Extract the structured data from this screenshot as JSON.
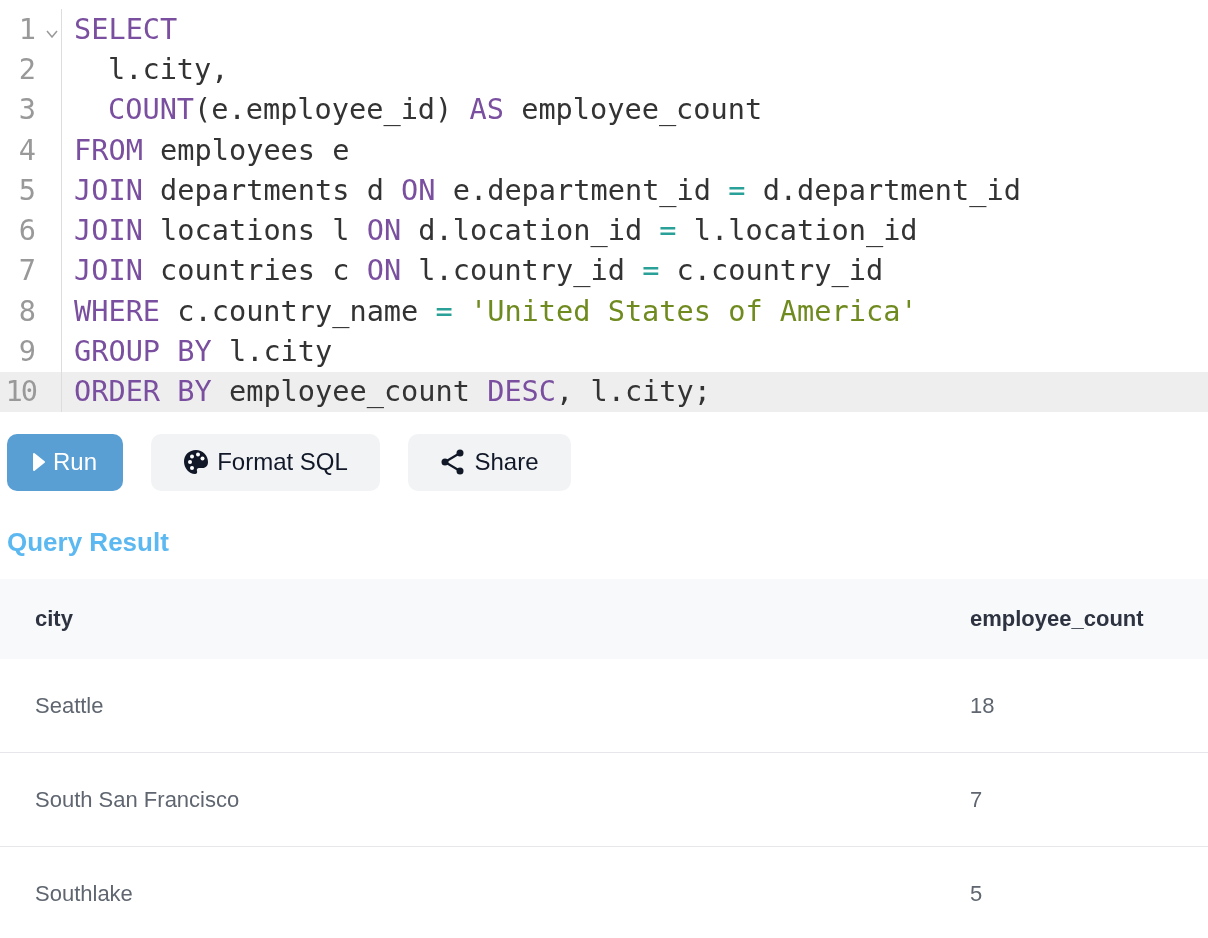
{
  "editor": {
    "lines": [
      {
        "number": "1",
        "foldable": true,
        "active": false,
        "tokens": [
          {
            "text": "SELECT",
            "kind": "keyword"
          }
        ]
      },
      {
        "number": "2",
        "foldable": false,
        "active": false,
        "indented": true,
        "tokens": [
          {
            "text": "l.city,",
            "kind": "plain"
          }
        ]
      },
      {
        "number": "3",
        "foldable": false,
        "active": false,
        "indented": true,
        "tokens": [
          {
            "text": "COUNT",
            "kind": "keyword"
          },
          {
            "text": "(e.employee_id) ",
            "kind": "plain"
          },
          {
            "text": "AS",
            "kind": "keyword"
          },
          {
            "text": " employee_count",
            "kind": "plain"
          }
        ]
      },
      {
        "number": "4",
        "foldable": false,
        "active": false,
        "tokens": [
          {
            "text": "FROM",
            "kind": "keyword"
          },
          {
            "text": " employees e",
            "kind": "plain"
          }
        ]
      },
      {
        "number": "5",
        "foldable": false,
        "active": false,
        "tokens": [
          {
            "text": "JOIN",
            "kind": "keyword"
          },
          {
            "text": " departments d ",
            "kind": "plain"
          },
          {
            "text": "ON",
            "kind": "keyword"
          },
          {
            "text": " e.department_id ",
            "kind": "plain"
          },
          {
            "text": "=",
            "kind": "operator"
          },
          {
            "text": " d.department_id",
            "kind": "plain"
          }
        ]
      },
      {
        "number": "6",
        "foldable": false,
        "active": false,
        "tokens": [
          {
            "text": "JOIN",
            "kind": "keyword"
          },
          {
            "text": " locations l ",
            "kind": "plain"
          },
          {
            "text": "ON",
            "kind": "keyword"
          },
          {
            "text": " d.location_id ",
            "kind": "plain"
          },
          {
            "text": "=",
            "kind": "operator"
          },
          {
            "text": " l.location_id",
            "kind": "plain"
          }
        ]
      },
      {
        "number": "7",
        "foldable": false,
        "active": false,
        "tokens": [
          {
            "text": "JOIN",
            "kind": "keyword"
          },
          {
            "text": " countries c ",
            "kind": "plain"
          },
          {
            "text": "ON",
            "kind": "keyword"
          },
          {
            "text": " l.country_id ",
            "kind": "plain"
          },
          {
            "text": "=",
            "kind": "operator"
          },
          {
            "text": " c.country_id",
            "kind": "plain"
          }
        ]
      },
      {
        "number": "8",
        "foldable": false,
        "active": false,
        "tokens": [
          {
            "text": "WHERE",
            "kind": "keyword"
          },
          {
            "text": " c.country_name ",
            "kind": "plain"
          },
          {
            "text": "= ",
            "kind": "operator"
          },
          {
            "text": "'United States of America'",
            "kind": "string"
          }
        ]
      },
      {
        "number": "9",
        "foldable": false,
        "active": false,
        "tokens": [
          {
            "text": "GROUP BY",
            "kind": "keyword"
          },
          {
            "text": " l.city",
            "kind": "plain"
          }
        ]
      },
      {
        "number": "10",
        "foldable": false,
        "active": true,
        "tokens": [
          {
            "text": "ORDER BY",
            "kind": "keyword"
          },
          {
            "text": " employee_count ",
            "kind": "plain"
          },
          {
            "text": "DESC",
            "kind": "keyword"
          },
          {
            "text": ", l.city;",
            "kind": "plain"
          }
        ]
      }
    ]
  },
  "buttons": [
    {
      "label": "Run",
      "kind": "primary"
    },
    {
      "label": "Format SQL",
      "kind": "format"
    },
    {
      "label": "Share",
      "kind": "share"
    }
  ],
  "result": {
    "title": "Query Result",
    "columns": [
      "city",
      "employee_count"
    ],
    "rows": [
      [
        "Seattle",
        "18"
      ],
      [
        "South San Francisco",
        "7"
      ],
      [
        "Southlake",
        "5"
      ]
    ]
  }
}
